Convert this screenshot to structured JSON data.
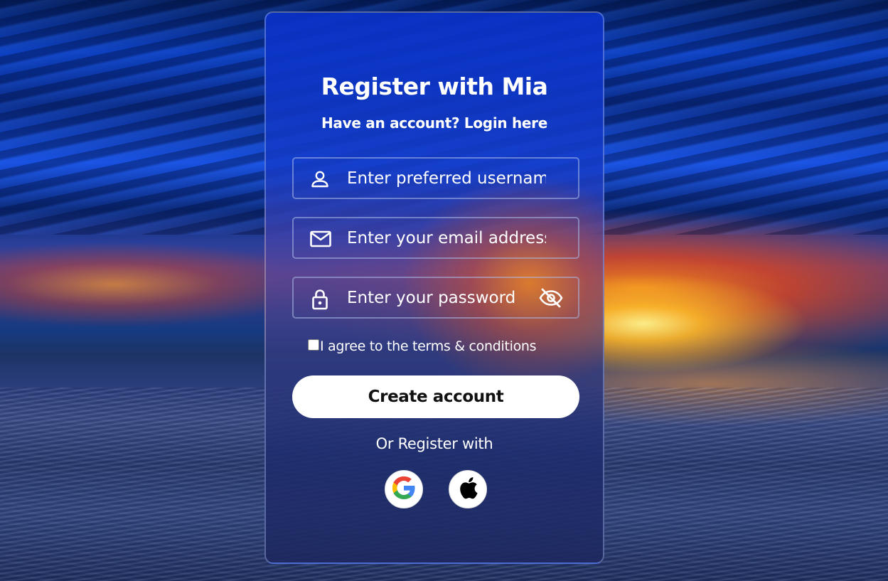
{
  "form": {
    "title": "Register with Mia",
    "subtitle": "Have an account? Login here",
    "username_placeholder": "Enter preferred username",
    "email_placeholder": "Enter your email address",
    "password_placeholder": "Enter your password",
    "terms_label": "I agree to the terms & conditions",
    "terms_checked": false,
    "create_button_label": "Create account",
    "or_register_label": "Or Register with"
  },
  "icons": {
    "username": "user-icon",
    "email": "mail-icon",
    "password": "lock-icon",
    "password_toggle": "eye-off-icon",
    "google": "google-icon",
    "apple": "apple-icon"
  },
  "colors": {
    "button_bg": "#ffffff",
    "button_text": "#111111",
    "text": "#ffffff"
  }
}
